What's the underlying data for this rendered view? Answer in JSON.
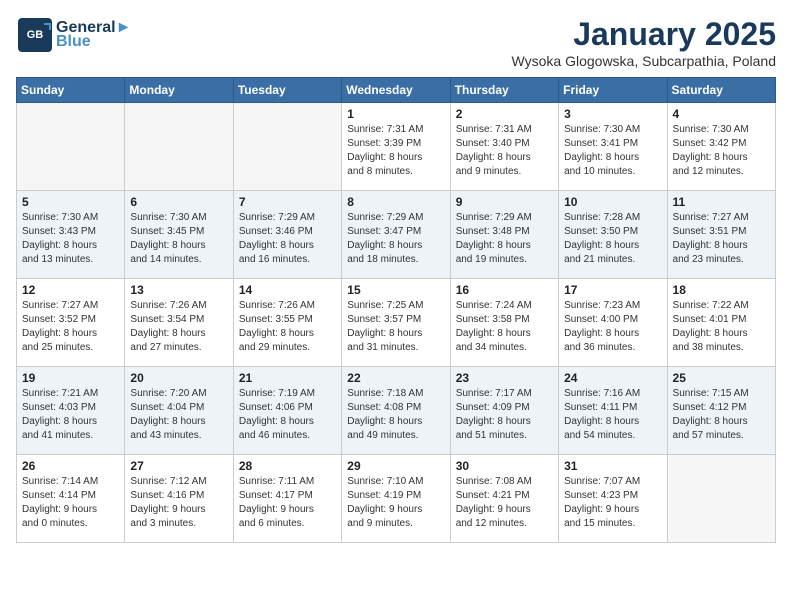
{
  "header": {
    "logo_line1": "General",
    "logo_line2": "Blue",
    "month": "January 2025",
    "location": "Wysoka Glogowska, Subcarpathia, Poland"
  },
  "weekdays": [
    "Sunday",
    "Monday",
    "Tuesday",
    "Wednesday",
    "Thursday",
    "Friday",
    "Saturday"
  ],
  "weeks": [
    [
      {
        "day": null,
        "info": null
      },
      {
        "day": null,
        "info": null
      },
      {
        "day": null,
        "info": null
      },
      {
        "day": "1",
        "info": "Sunrise: 7:31 AM\nSunset: 3:39 PM\nDaylight: 8 hours\nand 8 minutes."
      },
      {
        "day": "2",
        "info": "Sunrise: 7:31 AM\nSunset: 3:40 PM\nDaylight: 8 hours\nand 9 minutes."
      },
      {
        "day": "3",
        "info": "Sunrise: 7:30 AM\nSunset: 3:41 PM\nDaylight: 8 hours\nand 10 minutes."
      },
      {
        "day": "4",
        "info": "Sunrise: 7:30 AM\nSunset: 3:42 PM\nDaylight: 8 hours\nand 12 minutes."
      }
    ],
    [
      {
        "day": "5",
        "info": "Sunrise: 7:30 AM\nSunset: 3:43 PM\nDaylight: 8 hours\nand 13 minutes."
      },
      {
        "day": "6",
        "info": "Sunrise: 7:30 AM\nSunset: 3:45 PM\nDaylight: 8 hours\nand 14 minutes."
      },
      {
        "day": "7",
        "info": "Sunrise: 7:29 AM\nSunset: 3:46 PM\nDaylight: 8 hours\nand 16 minutes."
      },
      {
        "day": "8",
        "info": "Sunrise: 7:29 AM\nSunset: 3:47 PM\nDaylight: 8 hours\nand 18 minutes."
      },
      {
        "day": "9",
        "info": "Sunrise: 7:29 AM\nSunset: 3:48 PM\nDaylight: 8 hours\nand 19 minutes."
      },
      {
        "day": "10",
        "info": "Sunrise: 7:28 AM\nSunset: 3:50 PM\nDaylight: 8 hours\nand 21 minutes."
      },
      {
        "day": "11",
        "info": "Sunrise: 7:27 AM\nSunset: 3:51 PM\nDaylight: 8 hours\nand 23 minutes."
      }
    ],
    [
      {
        "day": "12",
        "info": "Sunrise: 7:27 AM\nSunset: 3:52 PM\nDaylight: 8 hours\nand 25 minutes."
      },
      {
        "day": "13",
        "info": "Sunrise: 7:26 AM\nSunset: 3:54 PM\nDaylight: 8 hours\nand 27 minutes."
      },
      {
        "day": "14",
        "info": "Sunrise: 7:26 AM\nSunset: 3:55 PM\nDaylight: 8 hours\nand 29 minutes."
      },
      {
        "day": "15",
        "info": "Sunrise: 7:25 AM\nSunset: 3:57 PM\nDaylight: 8 hours\nand 31 minutes."
      },
      {
        "day": "16",
        "info": "Sunrise: 7:24 AM\nSunset: 3:58 PM\nDaylight: 8 hours\nand 34 minutes."
      },
      {
        "day": "17",
        "info": "Sunrise: 7:23 AM\nSunset: 4:00 PM\nDaylight: 8 hours\nand 36 minutes."
      },
      {
        "day": "18",
        "info": "Sunrise: 7:22 AM\nSunset: 4:01 PM\nDaylight: 8 hours\nand 38 minutes."
      }
    ],
    [
      {
        "day": "19",
        "info": "Sunrise: 7:21 AM\nSunset: 4:03 PM\nDaylight: 8 hours\nand 41 minutes."
      },
      {
        "day": "20",
        "info": "Sunrise: 7:20 AM\nSunset: 4:04 PM\nDaylight: 8 hours\nand 43 minutes."
      },
      {
        "day": "21",
        "info": "Sunrise: 7:19 AM\nSunset: 4:06 PM\nDaylight: 8 hours\nand 46 minutes."
      },
      {
        "day": "22",
        "info": "Sunrise: 7:18 AM\nSunset: 4:08 PM\nDaylight: 8 hours\nand 49 minutes."
      },
      {
        "day": "23",
        "info": "Sunrise: 7:17 AM\nSunset: 4:09 PM\nDaylight: 8 hours\nand 51 minutes."
      },
      {
        "day": "24",
        "info": "Sunrise: 7:16 AM\nSunset: 4:11 PM\nDaylight: 8 hours\nand 54 minutes."
      },
      {
        "day": "25",
        "info": "Sunrise: 7:15 AM\nSunset: 4:12 PM\nDaylight: 8 hours\nand 57 minutes."
      }
    ],
    [
      {
        "day": "26",
        "info": "Sunrise: 7:14 AM\nSunset: 4:14 PM\nDaylight: 9 hours\nand 0 minutes."
      },
      {
        "day": "27",
        "info": "Sunrise: 7:12 AM\nSunset: 4:16 PM\nDaylight: 9 hours\nand 3 minutes."
      },
      {
        "day": "28",
        "info": "Sunrise: 7:11 AM\nSunset: 4:17 PM\nDaylight: 9 hours\nand 6 minutes."
      },
      {
        "day": "29",
        "info": "Sunrise: 7:10 AM\nSunset: 4:19 PM\nDaylight: 9 hours\nand 9 minutes."
      },
      {
        "day": "30",
        "info": "Sunrise: 7:08 AM\nSunset: 4:21 PM\nDaylight: 9 hours\nand 12 minutes."
      },
      {
        "day": "31",
        "info": "Sunrise: 7:07 AM\nSunset: 4:23 PM\nDaylight: 9 hours\nand 15 minutes."
      },
      {
        "day": null,
        "info": null
      }
    ]
  ]
}
